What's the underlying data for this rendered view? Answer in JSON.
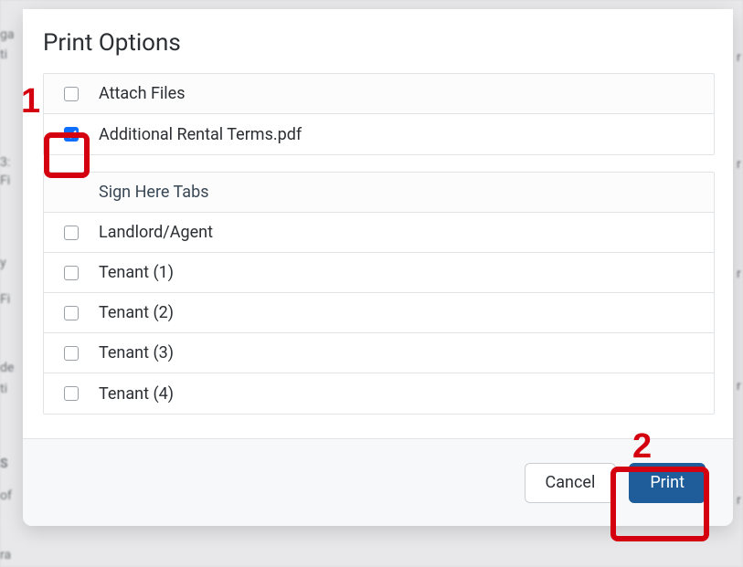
{
  "dialog": {
    "title": "Print Options",
    "sections": {
      "files": {
        "header_label": "Attach Files",
        "header_checked": false,
        "items": [
          {
            "label": "Additional Rental Terms.pdf",
            "checked": true
          }
        ]
      },
      "tabs": {
        "header_label": "Sign Here Tabs",
        "items": [
          {
            "label": "Landlord/Agent",
            "checked": false
          },
          {
            "label": "Tenant (1)",
            "checked": false
          },
          {
            "label": "Tenant (2)",
            "checked": false
          },
          {
            "label": "Tenant (3)",
            "checked": false
          },
          {
            "label": "Tenant (4)",
            "checked": false
          }
        ]
      }
    },
    "buttons": {
      "cancel": "Cancel",
      "print": "Print"
    }
  },
  "annotations": {
    "step1": "1",
    "step2": "2"
  }
}
